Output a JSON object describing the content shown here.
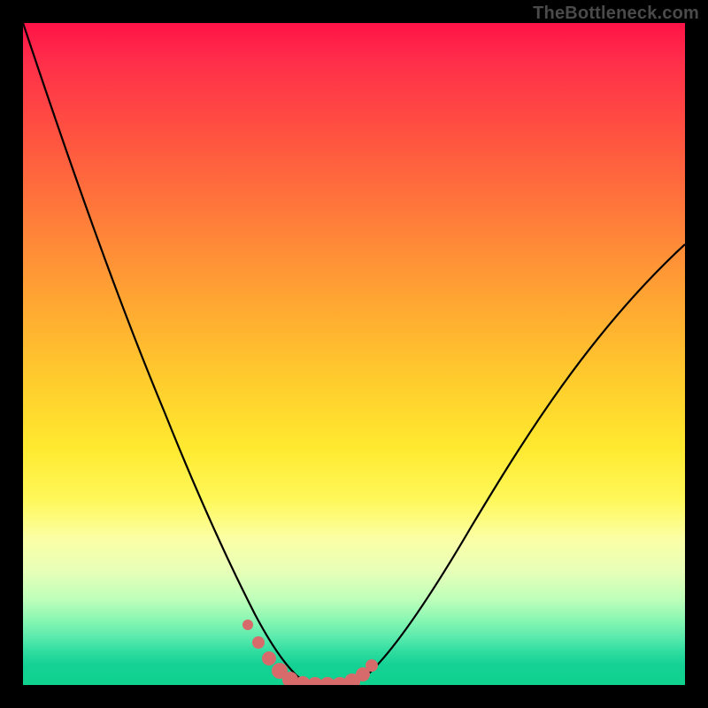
{
  "watermark": "TheBottleneck.com",
  "chart_data": {
    "type": "line",
    "title": "",
    "xlabel": "",
    "ylabel": "",
    "x": [
      0.0,
      0.03,
      0.06,
      0.09,
      0.12,
      0.15,
      0.18,
      0.21,
      0.24,
      0.27,
      0.3,
      0.32,
      0.34,
      0.36,
      0.38,
      0.4,
      0.42,
      0.44,
      0.46,
      0.48,
      0.52,
      0.56,
      0.6,
      0.66,
      0.72,
      0.78,
      0.84,
      0.9,
      0.95,
      1.0
    ],
    "values": [
      100,
      90,
      80,
      71,
      62,
      54,
      46,
      38,
      31,
      24,
      17,
      13,
      9,
      6,
      3,
      1,
      0,
      0,
      1,
      3,
      7,
      12,
      18,
      26,
      34,
      42,
      50,
      57,
      62,
      67
    ],
    "ylim": [
      0,
      100
    ],
    "xlim": [
      0,
      1
    ],
    "gradient_stops": [
      {
        "pos": 0.0,
        "color": "#ff1347"
      },
      {
        "pos": 0.5,
        "color": "#ffcc2d"
      },
      {
        "pos": 0.78,
        "color": "#fbffa6"
      },
      {
        "pos": 1.0,
        "color": "#0fd28e"
      }
    ],
    "markers": {
      "color": "#d76b6b",
      "radius_small": 6,
      "radius_large": 9,
      "points_x": [
        0.33,
        0.35,
        0.37,
        0.39,
        0.41,
        0.43,
        0.45,
        0.47,
        0.49,
        0.5
      ],
      "points_y": [
        11,
        8,
        5,
        2,
        0,
        0,
        0,
        1,
        3,
        5
      ]
    },
    "background_heat": "vertical gradient red→green indicating bottleneck severity"
  }
}
